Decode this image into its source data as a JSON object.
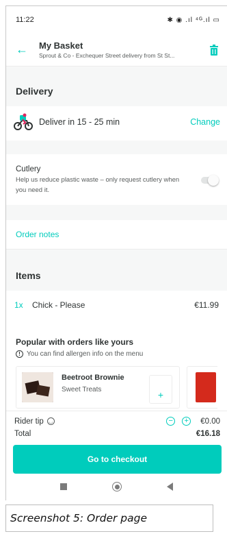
{
  "status_bar": {
    "time": "11:22",
    "icons": "✱ ◉ .ıl ⁴ᴳ.ıl ▭"
  },
  "header": {
    "title": "My Basket",
    "subtitle": "Sprout & Co - Exchequer Street delivery from St St..."
  },
  "delivery": {
    "section_title": "Delivery",
    "eta_text": "Deliver in 15 - 25 min",
    "change_label": "Change"
  },
  "cutlery": {
    "title": "Cutlery",
    "description": "Help us reduce plastic waste – only request cutlery when you need it.",
    "enabled": false
  },
  "order_notes": {
    "label": "Order notes"
  },
  "items": {
    "section_title": "Items",
    "list": [
      {
        "qty": "1x",
        "name": "Chick - Please",
        "price": "€11.99"
      }
    ]
  },
  "popular": {
    "title": "Popular with orders like yours",
    "allergen_note": "You can find allergen info on the menu",
    "cards": [
      {
        "name": "Beetroot Brownie",
        "category": "Sweet Treats",
        "add_label": "+"
      }
    ]
  },
  "footer": {
    "rider_tip_label": "Rider tip",
    "tip_value": "€0.00",
    "minus_label": "−",
    "plus_label": "+",
    "total_label": "Total",
    "total_value": "€16.18",
    "checkout_label": "Go to checkout"
  },
  "caption": "Screenshot 5: Order page",
  "colors": {
    "accent": "#00ccbc",
    "text": "#2e3333",
    "muted": "#585c5c",
    "section_bg": "#f6f7f7"
  },
  "icons": [
    "back-arrow-icon",
    "trash-icon",
    "rider-icon",
    "info-icon",
    "smile-icon",
    "minus-icon",
    "plus-icon"
  ]
}
